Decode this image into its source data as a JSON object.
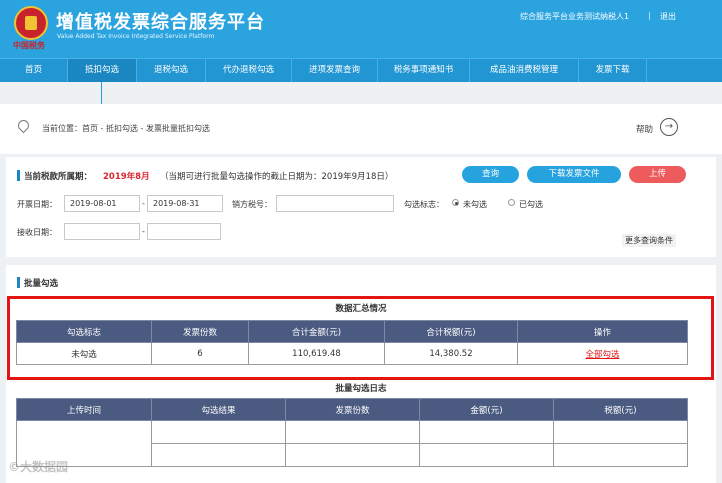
{
  "header": {
    "logo_text": "中国税务",
    "title": "增值税发票综合服务平台",
    "subtitle": "Value Added Tax Invoice Integrated Service Platform",
    "user_info": "综合服务平台业务测试纳税人1",
    "divider": "|",
    "logout": "退出"
  },
  "nav": {
    "items": [
      {
        "label": "首页"
      },
      {
        "label": "抵扣勾选"
      },
      {
        "label": "退税勾选"
      },
      {
        "label": "代办退税勾选"
      },
      {
        "label": "进项发票查询"
      },
      {
        "label": "税务事项通知书"
      },
      {
        "label": "成品油消费税管理"
      },
      {
        "label": "发票下载"
      }
    ],
    "active_index": 1
  },
  "breadcrumb": {
    "text": "当前位置：首页 - 抵扣勾选 - 发票批量抵扣勾选",
    "help": "帮助",
    "help_icon": "→"
  },
  "query": {
    "period_label": "当前税款所属期：",
    "period_value": "2019年8月",
    "period_note": "（当期可进行批量勾选操作的截止日期为：2019年9月18日）",
    "buttons": {
      "query": "查询",
      "download": "下载发票文件",
      "upload": "上传"
    },
    "invoice_date_label": "开票日期：",
    "invoice_date_from": "2019-08-01",
    "date_sep": "-",
    "invoice_date_to": "2019-08-31",
    "seller_tax_label": "销方税号：",
    "seller_tax_value": "",
    "select_flag_label": "勾选标志：",
    "option_unselected": "未勾选",
    "option_selected": "已勾选",
    "receive_date_label": "接收日期：",
    "receive_date_from": "",
    "receive_date_to": "",
    "more_conditions": "更多查询条件"
  },
  "batch": {
    "section_title": "批量勾选",
    "summary_caption": "数据汇总情况",
    "summary_headers": [
      "勾选标志",
      "发票份数",
      "合计金额(元)",
      "合计税额(元)",
      "操作"
    ],
    "summary_row": {
      "flag": "未勾选",
      "count": "6",
      "amount": "110,619.48",
      "tax": "14,380.52",
      "action": "全部勾选"
    },
    "log_caption": "批量勾选日志",
    "log_headers": [
      "上传时间",
      "勾选结果",
      "发票份数",
      "金额(元)",
      "税额(元)"
    ]
  },
  "watermark": "©大数据园",
  "colors": {
    "header": "#2aa3df",
    "nav": "#2296d2",
    "table_header": "#4a5a80",
    "highlight": "#e31414",
    "period": "#d9272e"
  }
}
